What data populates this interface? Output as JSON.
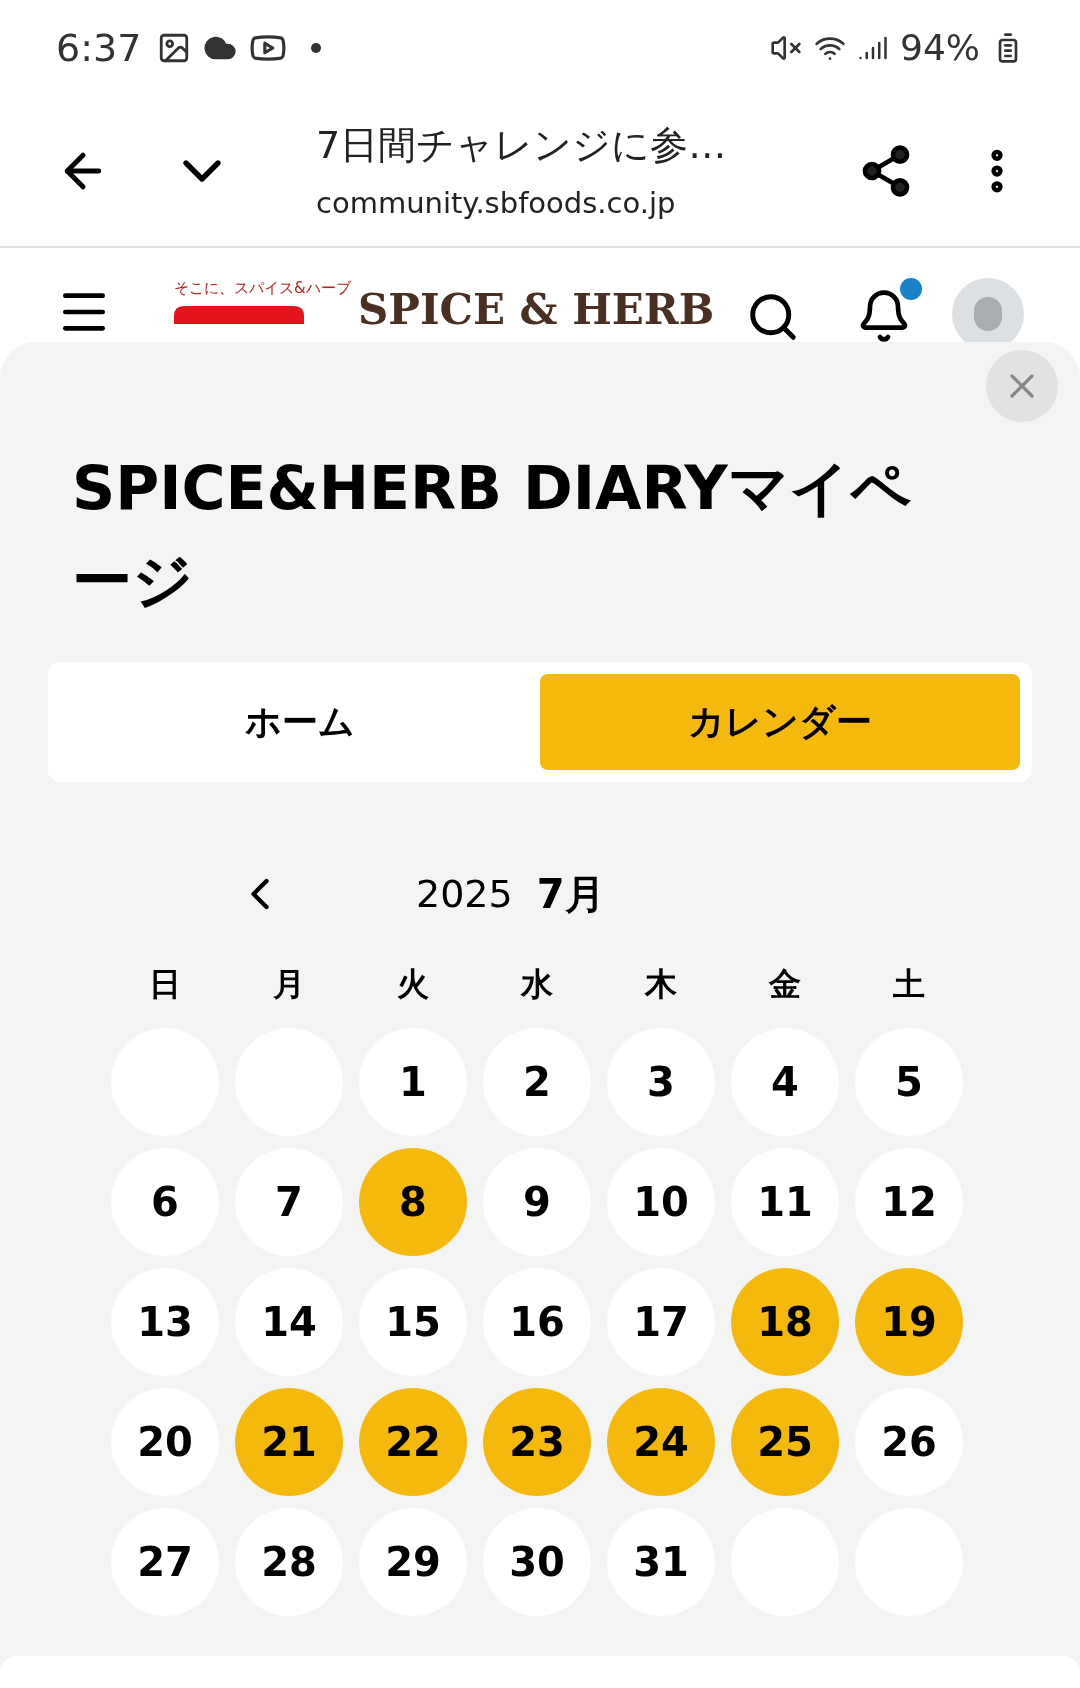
{
  "status_bar": {
    "time": "6:37",
    "battery": "94%"
  },
  "browser": {
    "title": "7日間チャレンジに参…",
    "url": "community.sbfoods.co.jp"
  },
  "site_header": {
    "tagline": "そこに、スパイス&ハーブ",
    "logo_title": "SPICE & HERB",
    "has_notification": true
  },
  "sheet": {
    "title": "SPICE&HERB DIARYマイページ",
    "tabs": [
      {
        "label": "ホーム",
        "selected": false
      },
      {
        "label": "カレンダー",
        "selected": true
      }
    ],
    "calendar": {
      "year": "2025",
      "month": "7月",
      "weekdays": [
        "日",
        "月",
        "火",
        "水",
        "木",
        "金",
        "土"
      ],
      "weeks": [
        [
          {
            "kind": "empty"
          },
          {
            "kind": "empty"
          },
          {
            "kind": "day",
            "day": "1",
            "highlighted": false
          },
          {
            "kind": "day",
            "day": "2",
            "highlighted": false
          },
          {
            "kind": "day",
            "day": "3",
            "highlighted": false
          },
          {
            "kind": "day",
            "day": "4",
            "highlighted": false
          },
          {
            "kind": "day",
            "day": "5",
            "highlighted": false
          }
        ],
        [
          {
            "kind": "day",
            "day": "6",
            "highlighted": false
          },
          {
            "kind": "day",
            "day": "7",
            "highlighted": false
          },
          {
            "kind": "day",
            "day": "8",
            "highlighted": true
          },
          {
            "kind": "day",
            "day": "9",
            "highlighted": false
          },
          {
            "kind": "day",
            "day": "10",
            "highlighted": false
          },
          {
            "kind": "day",
            "day": "11",
            "highlighted": false
          },
          {
            "kind": "day",
            "day": "12",
            "highlighted": false
          }
        ],
        [
          {
            "kind": "day",
            "day": "13",
            "highlighted": false
          },
          {
            "kind": "day",
            "day": "14",
            "highlighted": false
          },
          {
            "kind": "day",
            "day": "15",
            "highlighted": false
          },
          {
            "kind": "day",
            "day": "16",
            "highlighted": false
          },
          {
            "kind": "day",
            "day": "17",
            "highlighted": false
          },
          {
            "kind": "day",
            "day": "18",
            "highlighted": true
          },
          {
            "kind": "day",
            "day": "19",
            "highlighted": true
          }
        ],
        [
          {
            "kind": "day",
            "day": "20",
            "highlighted": false
          },
          {
            "kind": "day",
            "day": "21",
            "highlighted": true
          },
          {
            "kind": "day",
            "day": "22",
            "highlighted": true
          },
          {
            "kind": "day",
            "day": "23",
            "highlighted": true
          },
          {
            "kind": "day",
            "day": "24",
            "highlighted": true
          },
          {
            "kind": "day",
            "day": "25",
            "highlighted": true
          },
          {
            "kind": "day",
            "day": "26",
            "highlighted": false
          }
        ],
        [
          {
            "kind": "day",
            "day": "27",
            "highlighted": false
          },
          {
            "kind": "day",
            "day": "28",
            "highlighted": false
          },
          {
            "kind": "day",
            "day": "29",
            "highlighted": false
          },
          {
            "kind": "day",
            "day": "30",
            "highlighted": false
          },
          {
            "kind": "day",
            "day": "31",
            "highlighted": false
          },
          {
            "kind": "empty"
          },
          {
            "kind": "empty"
          }
        ]
      ]
    }
  }
}
